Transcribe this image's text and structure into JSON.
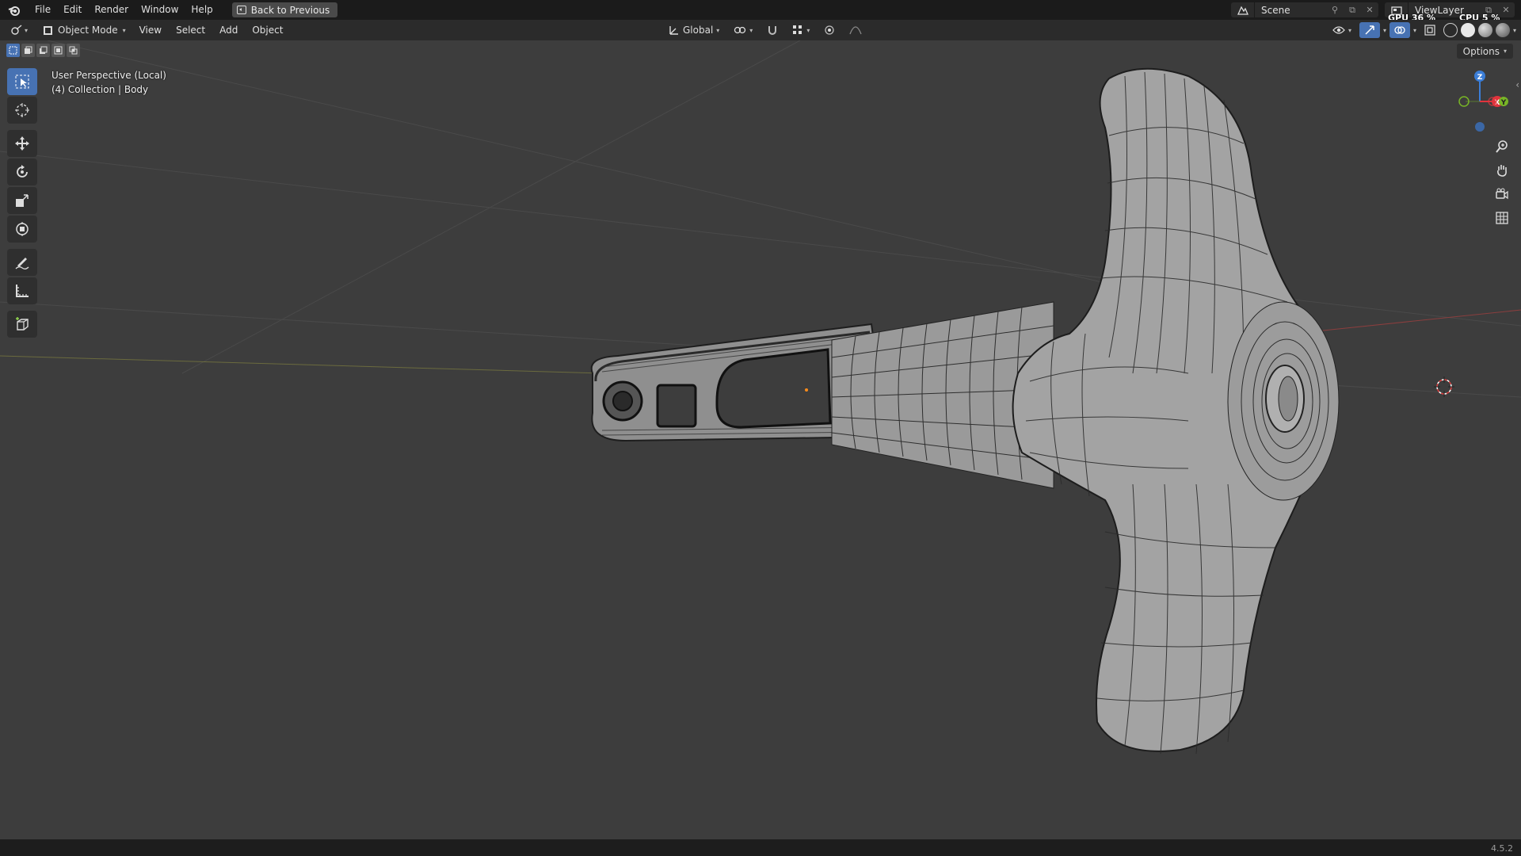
{
  "menubar": {
    "items": [
      "File",
      "Edit",
      "Render",
      "Window",
      "Help"
    ],
    "back_button": "Back to Previous"
  },
  "scene": {
    "name": "Scene"
  },
  "view_layer": {
    "name": "ViewLayer"
  },
  "performance": {
    "gpu": "GPU 36 %",
    "cpu": "CPU 5 %"
  },
  "header": {
    "mode": "Object Mode",
    "menus": [
      "View",
      "Select",
      "Add",
      "Object"
    ],
    "transform_orientation": "Global"
  },
  "viewport": {
    "perspective": "User Perspective (Local)",
    "collection_info": "(4) Collection | Body",
    "options_label": "Options"
  },
  "gizmo": {
    "z": "Z",
    "x": "X",
    "y": "Y"
  },
  "status": {
    "version": "4.5.2"
  },
  "colors": {
    "accent": "#4772b3",
    "x_axis": "#e0343c",
    "y_axis": "#78b526",
    "z_axis": "#3b7ed8",
    "background": "#3d3d3d"
  },
  "tools": [
    "select-box",
    "cursor",
    "move",
    "rotate",
    "scale",
    "transform",
    "annotate",
    "measure",
    "add-cube"
  ]
}
